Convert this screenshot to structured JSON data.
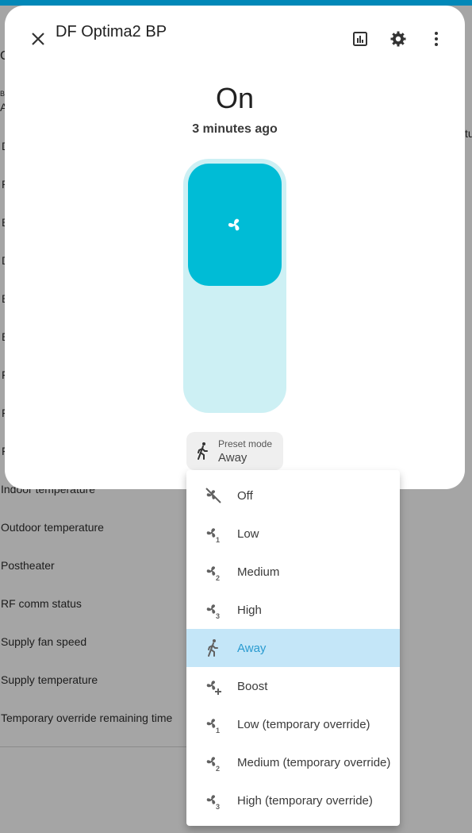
{
  "background": {
    "rows": [
      "Indoor temperature",
      "Outdoor temperature",
      "Postheater",
      "RF comm status",
      "Supply fan speed",
      "Supply temperature",
      "Temporary override remaining time"
    ],
    "left_stubs": [
      "C",
      "By",
      "A",
      "D",
      "P",
      "B",
      "D",
      "B",
      "E",
      "F",
      "F",
      "F"
    ],
    "right_stub": "tu"
  },
  "dialog": {
    "title": "DF Optima2 BP",
    "state": "On",
    "last_changed": "3 minutes ago",
    "fan_level_fraction": 0.5,
    "preset": {
      "label": "Preset mode",
      "value": "Away"
    }
  },
  "menu": {
    "items": [
      {
        "label": "Off",
        "icon": "fan-off-icon"
      },
      {
        "label": "Low",
        "icon": "fan-speed-1-icon"
      },
      {
        "label": "Medium",
        "icon": "fan-speed-2-icon"
      },
      {
        "label": "High",
        "icon": "fan-speed-3-icon"
      },
      {
        "label": "Away",
        "icon": "walk-icon",
        "selected": true
      },
      {
        "label": "Boost",
        "icon": "fan-plus-icon"
      },
      {
        "label": "Low (temporary override)",
        "icon": "fan-speed-1-icon"
      },
      {
        "label": "Medium (temporary override)",
        "icon": "fan-speed-2-icon"
      },
      {
        "label": "High (temporary override)",
        "icon": "fan-speed-3-icon"
      }
    ]
  },
  "colors": {
    "accent": "#00bcd6",
    "accent_light": "#cdf0f4",
    "selected_bg": "#c4e6f8",
    "selected_text": "#2a9bd0",
    "topbar": "#0288b8"
  }
}
